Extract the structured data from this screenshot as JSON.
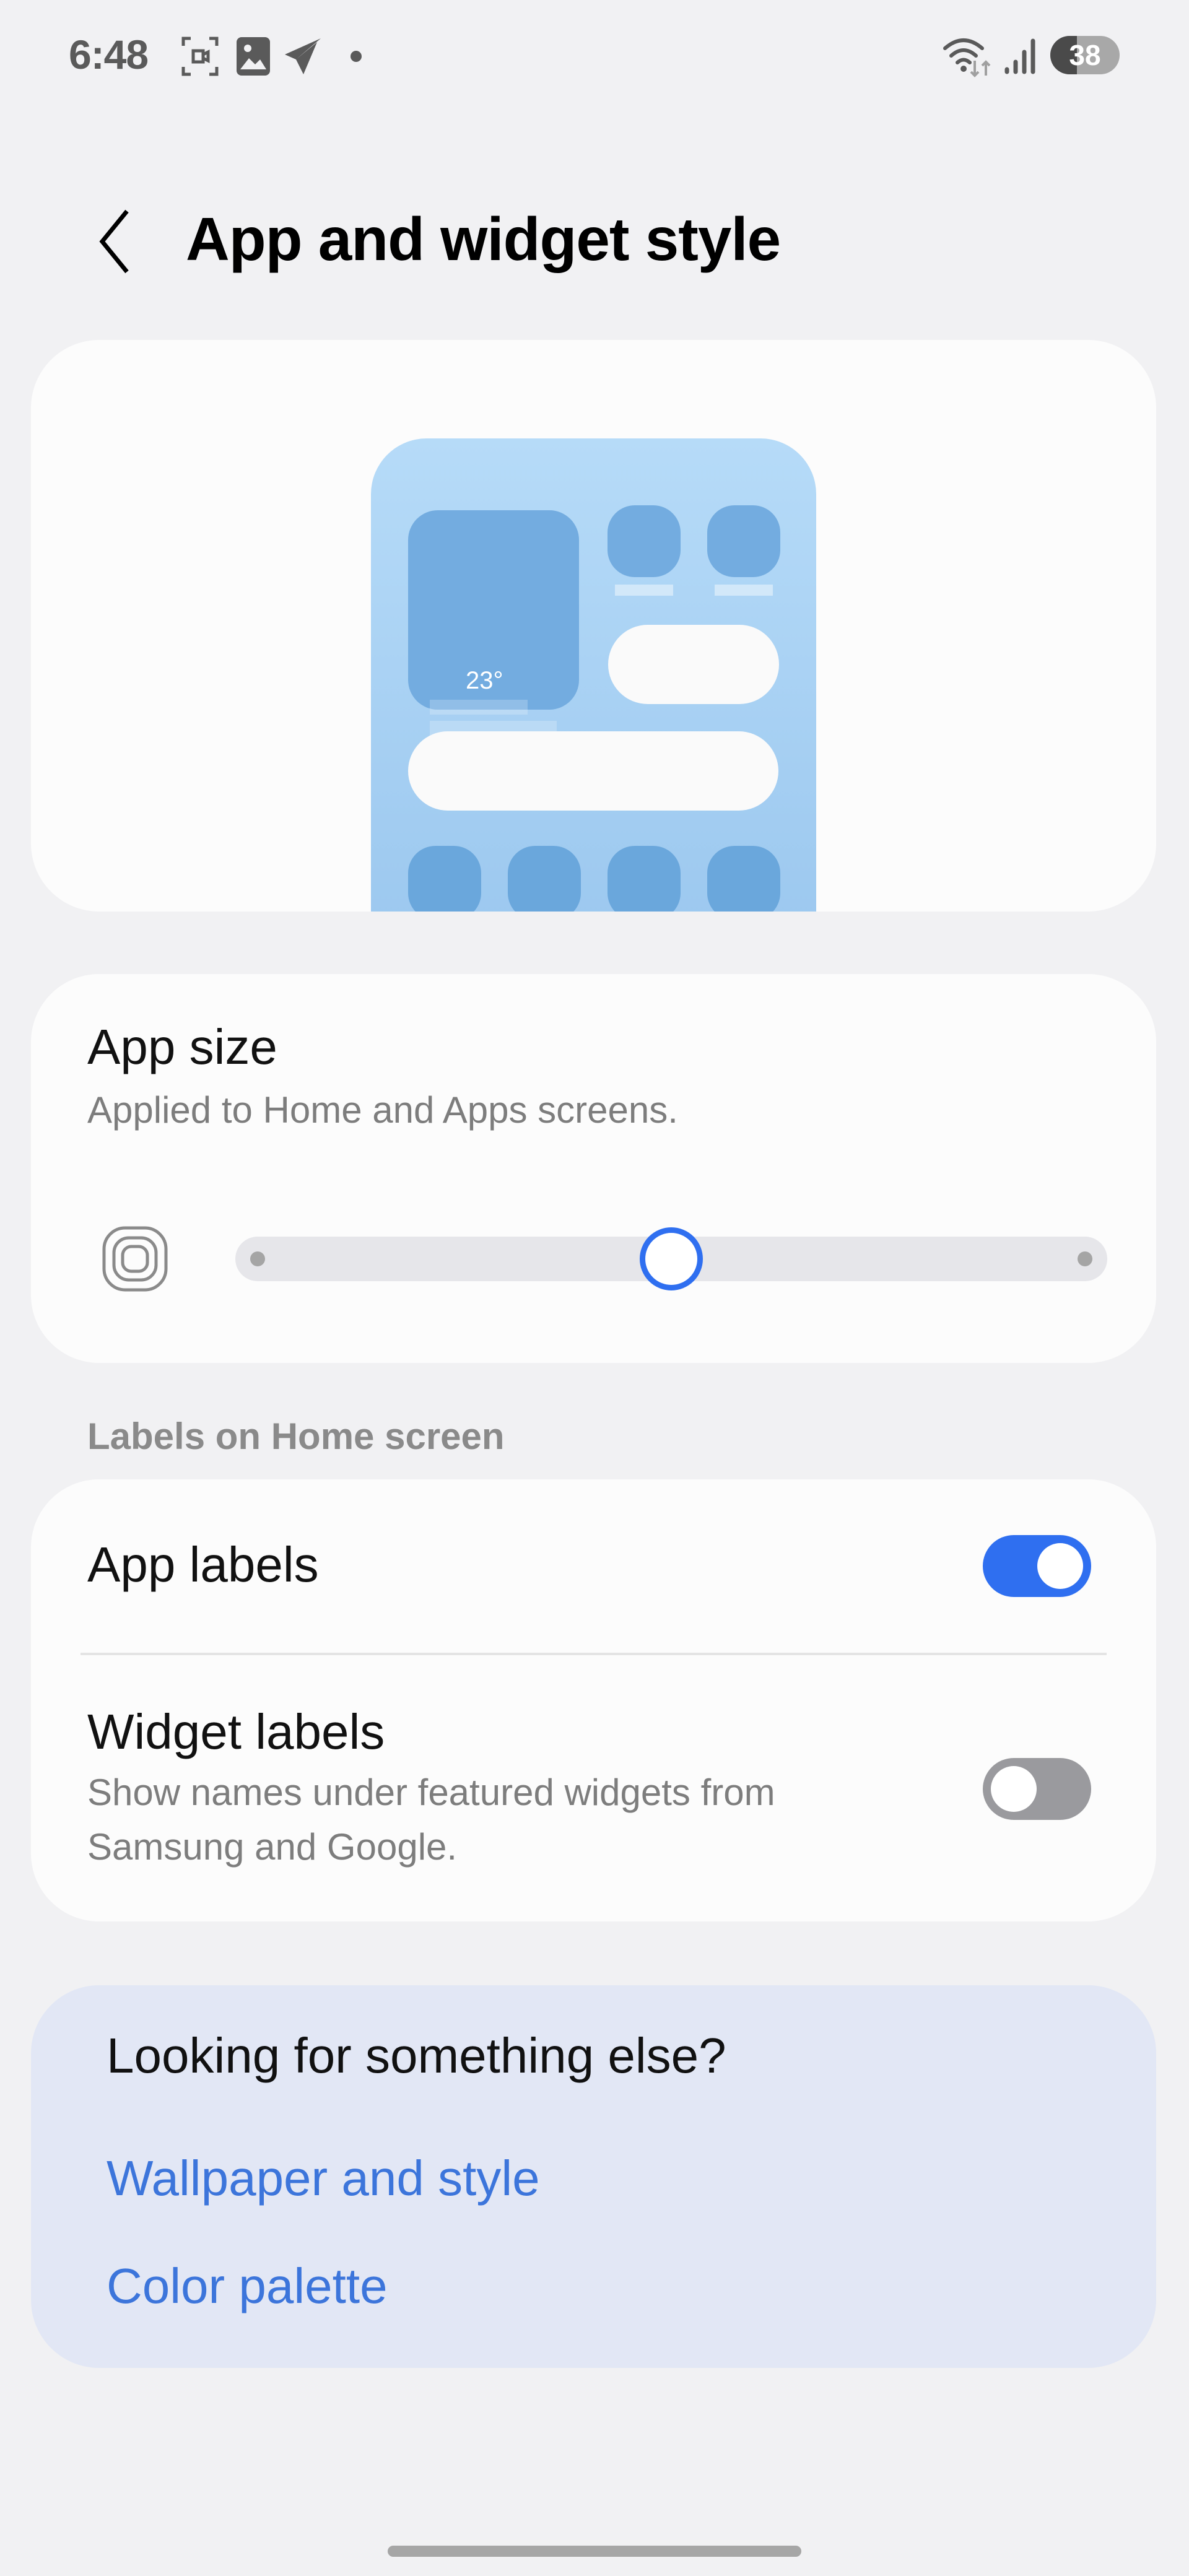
{
  "status_bar": {
    "time": "6:48",
    "left_icons": [
      "screen-record-icon",
      "gallery-icon",
      "telegram-icon",
      "notification-dot-icon"
    ],
    "right_icons": [
      "wifi-data-icon",
      "signal-icon"
    ],
    "battery": "38",
    "battery_percent": 38
  },
  "header": {
    "back_icon": "chevron-left-icon",
    "title": "App and widget style"
  },
  "preview": {
    "weather_temp": "23°"
  },
  "app_size": {
    "title": "App size",
    "subtitle": "Applied to Home and Apps screens.",
    "icon": "app-size-icon",
    "slider_value": 0.5,
    "slider_steps": 3
  },
  "labels_section": {
    "header": "Labels on Home screen",
    "items": [
      {
        "title": "App labels",
        "subtitle": "",
        "enabled": true
      },
      {
        "title": "Widget labels",
        "subtitle": "Show names under featured widgets from Samsung and Google.",
        "enabled": false
      }
    ]
  },
  "looking": {
    "title": "Looking for something else?",
    "links": [
      "Wallpaper and style",
      "Color palette"
    ]
  },
  "colors": {
    "accent": "#2f6ff0",
    "link": "#3c75db",
    "toggle_off": "#9a9a9e",
    "background": "#f1f1f3",
    "suggestion_card": "#e2e7f5"
  }
}
